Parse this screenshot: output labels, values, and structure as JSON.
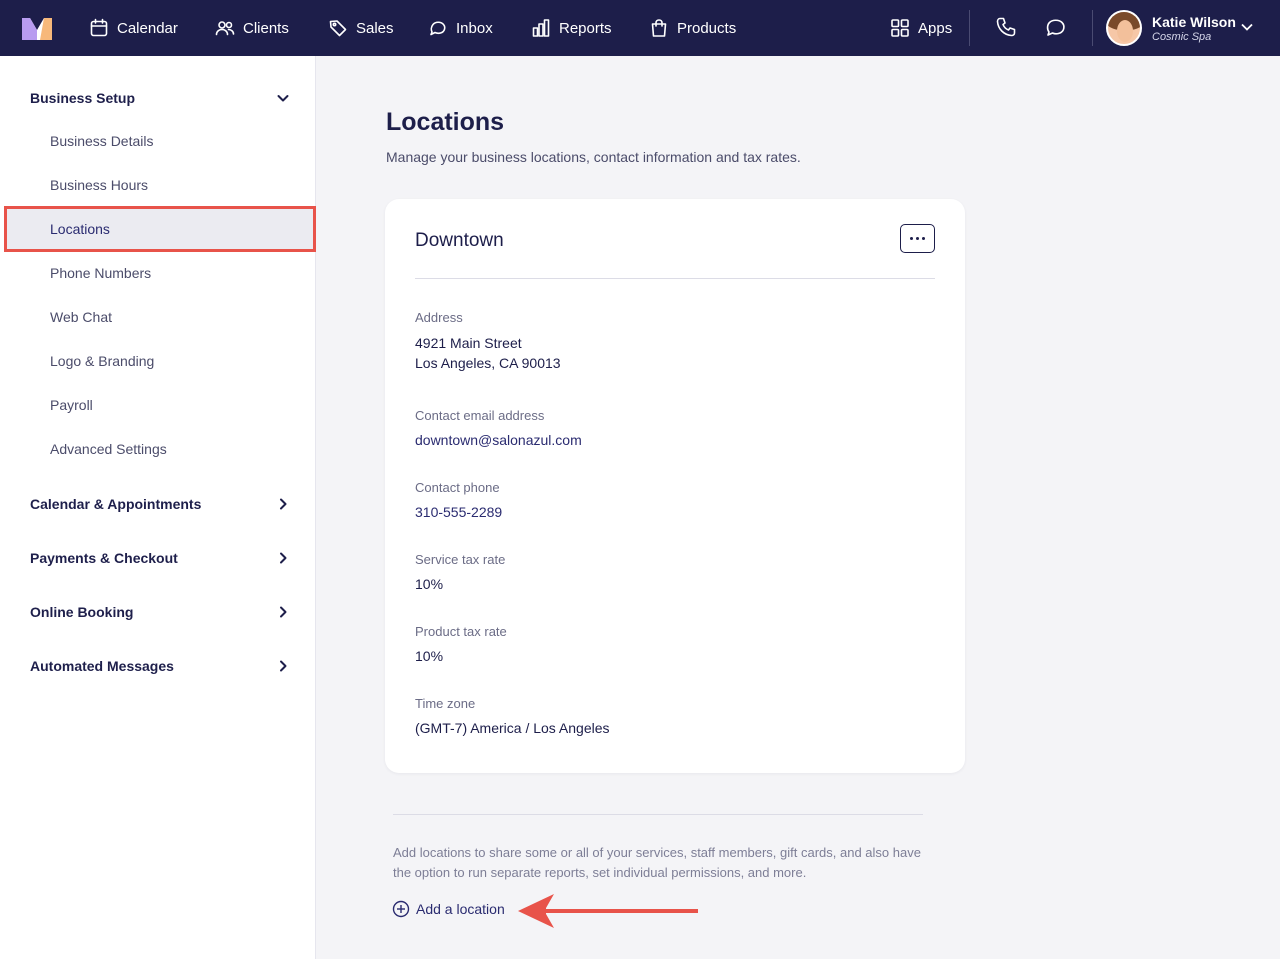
{
  "nav": {
    "items": [
      {
        "label": "Calendar",
        "icon": "calendar-icon"
      },
      {
        "label": "Clients",
        "icon": "users-icon"
      },
      {
        "label": "Sales",
        "icon": "tag-icon"
      },
      {
        "label": "Inbox",
        "icon": "inbox-icon"
      },
      {
        "label": "Reports",
        "icon": "bar-chart-icon"
      },
      {
        "label": "Products",
        "icon": "shopping-bag-icon"
      }
    ],
    "apps_label": "Apps",
    "user": {
      "name": "Katie Wilson",
      "org": "Cosmic Spa"
    }
  },
  "sidebar": {
    "sections": [
      {
        "label": "Business Setup",
        "expanded": true
      },
      {
        "label": "Calendar & Appointments",
        "expanded": false
      },
      {
        "label": "Payments & Checkout",
        "expanded": false
      },
      {
        "label": "Online Booking",
        "expanded": false
      },
      {
        "label": "Automated Messages",
        "expanded": false
      }
    ],
    "items": [
      {
        "label": "Business Details"
      },
      {
        "label": "Business Hours"
      },
      {
        "label": "Locations",
        "active": true
      },
      {
        "label": "Phone Numbers"
      },
      {
        "label": "Web Chat"
      },
      {
        "label": "Logo & Branding"
      },
      {
        "label": "Payroll"
      },
      {
        "label": "Advanced Settings"
      }
    ]
  },
  "main": {
    "title": "Locations",
    "subtitle": "Manage your business locations, contact information and tax rates.",
    "location": {
      "name": "Downtown",
      "fields": {
        "address_label": "Address",
        "address_line1": "4921 Main Street",
        "address_line2": "Los Angeles, CA 90013",
        "email_label": "Contact email address",
        "email": "downtown@salonazul.com",
        "phone_label": "Contact phone",
        "phone": "310-555-2289",
        "service_tax_label": "Service tax rate",
        "service_tax": "10%",
        "product_tax_label": "Product tax rate",
        "product_tax": "10%",
        "timezone_label": "Time zone",
        "timezone": "(GMT-7) America / Los Angeles"
      }
    },
    "help_text": "Add locations to share some or all of your services, staff members, gift cards, and also have the option to run separate reports, set individual permissions, and more.",
    "add_location_label": "Add a location"
  },
  "colors": {
    "nav_bg": "#1d1e4a",
    "accent": "#2a2b70",
    "highlight": "#e8534a",
    "page_bg": "#f4f4f7"
  }
}
